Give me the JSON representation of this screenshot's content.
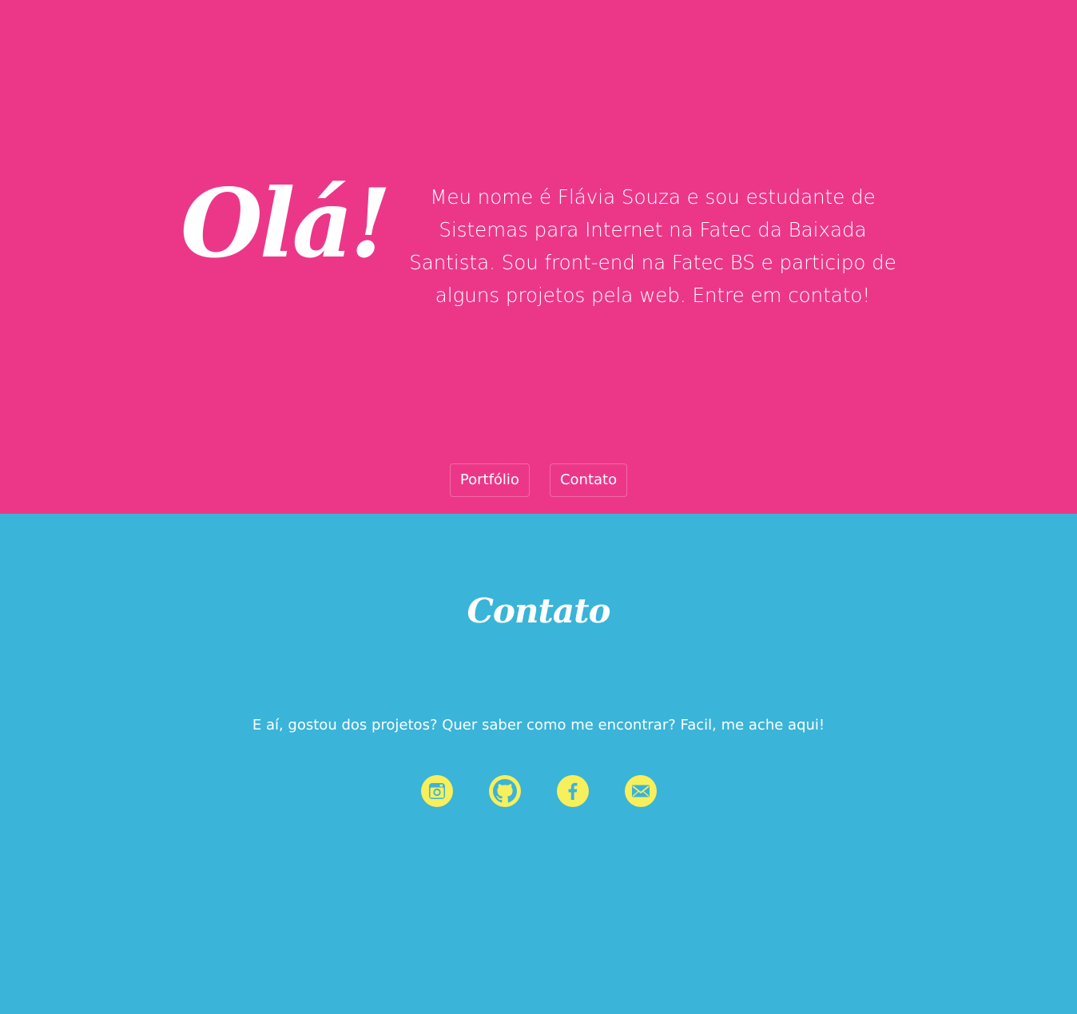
{
  "hero": {
    "greeting": "Olá!",
    "intro": "Meu nome é Flávia Souza e sou estudante de Sistemas para Internet na Fatec da Baixada Santista. Sou front-end na Fatec BS e participo de alguns projetos pela web. Entre em contato!",
    "nav": {
      "portfolio_label": "Portfólio",
      "contact_label": "Contato"
    }
  },
  "contact": {
    "title": "Contato",
    "text": "E aí, gostou dos projetos? Quer saber como me encontrar? Facil, me ache aqui!",
    "social": [
      {
        "icon": "instagram-icon"
      },
      {
        "icon": "github-icon"
      },
      {
        "icon": "facebook-icon"
      },
      {
        "icon": "email-icon"
      }
    ]
  },
  "colors": {
    "hero_background": "#ec3789",
    "contact_background": "#3ab4d8",
    "icon_background": "#f7ef5c",
    "text": "#ffffff"
  }
}
